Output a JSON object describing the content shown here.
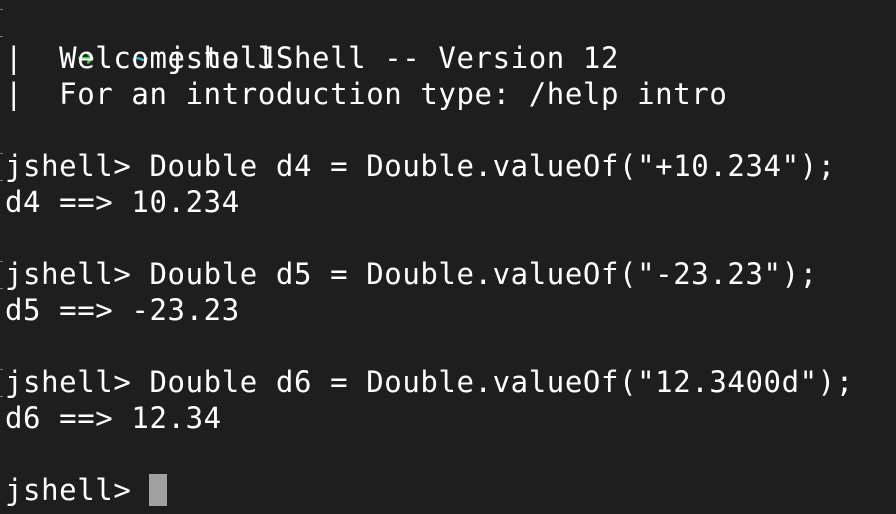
{
  "terminal": {
    "shell_prompt": {
      "arrow_icon": "right-arrow-icon",
      "cwd": "~",
      "command": "jshell"
    },
    "banner": [
      "|  Welcome to JShell -- Version 12",
      "|  For an introduction type: /help intro"
    ],
    "prompt": "jshell> ",
    "entries": [
      {
        "input": "Double d4 = Double.valueOf(\"+10.234\");",
        "output": "d4 ==> 10.234"
      },
      {
        "input": "Double d5 = Double.valueOf(\"-23.23\");",
        "output": "d5 ==> -23.23"
      },
      {
        "input": "Double d6 = Double.valueOf(\"12.3400d\");",
        "output": "d6 ==> 12.34"
      }
    ],
    "current_input": "",
    "colors": {
      "background": "#1e1e1e",
      "foreground": "#ffffff",
      "arrow": "#3fc73f",
      "tilde": "#3fb8c8",
      "cursor": "#a0a0a0"
    }
  }
}
